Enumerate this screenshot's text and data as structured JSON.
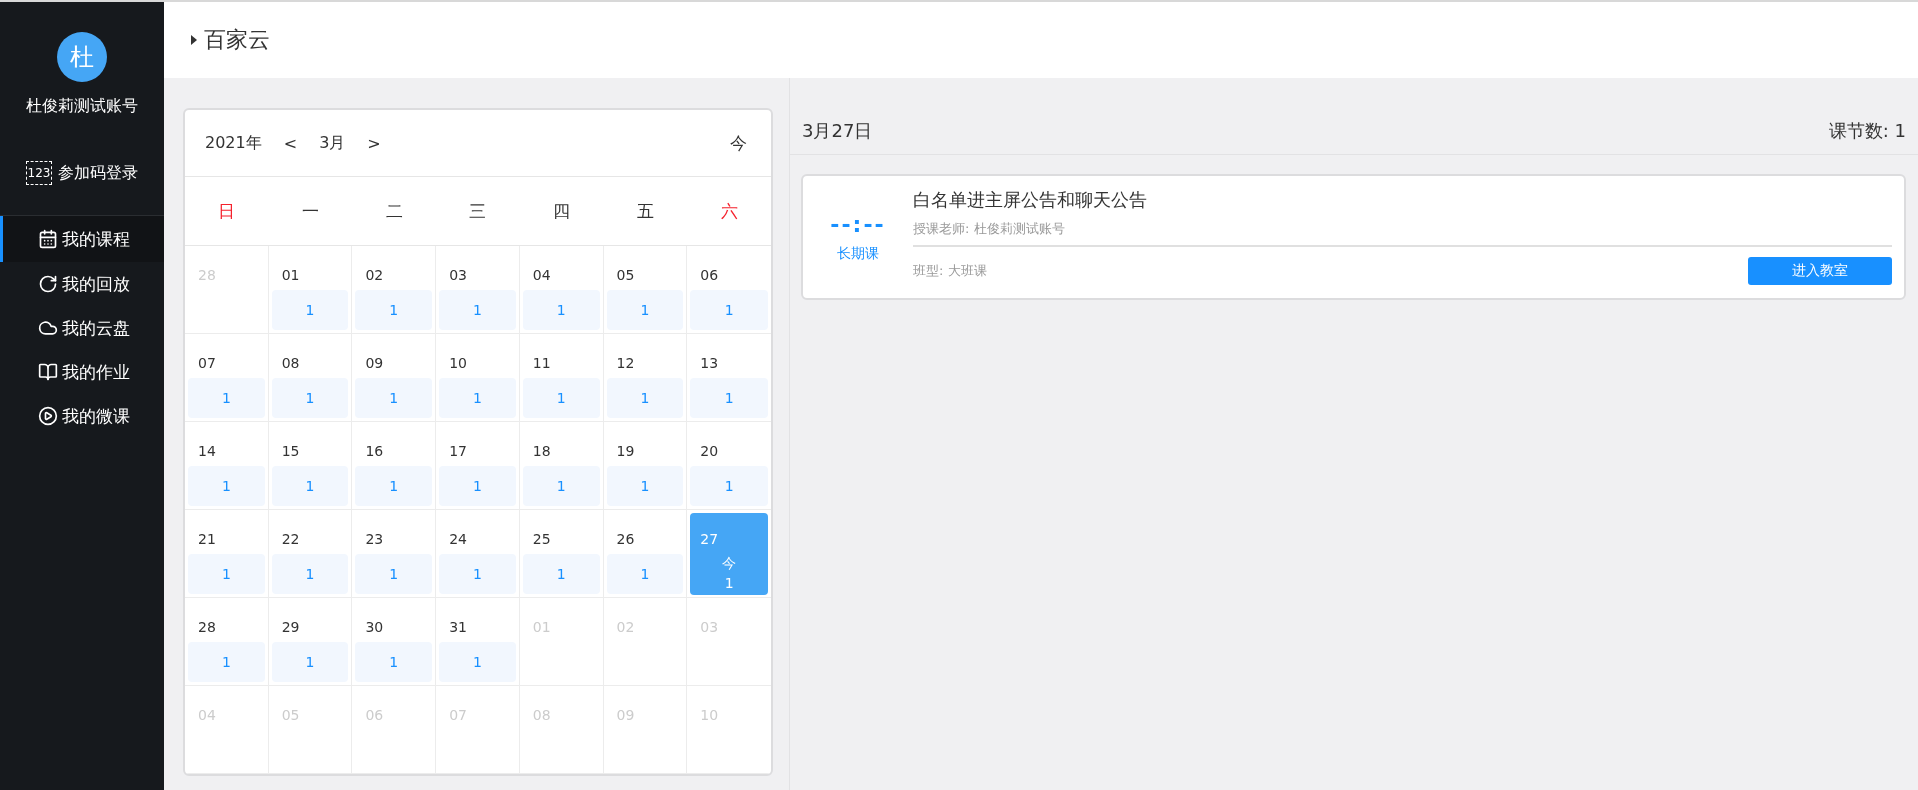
{
  "sidebar": {
    "avatar": "杜",
    "user_name": "杜俊莉测试账号",
    "join_code": {
      "icon_text": "123",
      "label": "参加码登录"
    },
    "items": [
      {
        "kind": "calendar",
        "label": "我的课程",
        "selected": true
      },
      {
        "kind": "replay",
        "label": "我的回放",
        "selected": false
      },
      {
        "kind": "cloud",
        "label": "我的云盘",
        "selected": false
      },
      {
        "kind": "homework",
        "label": "我的作业",
        "selected": false
      },
      {
        "kind": "play",
        "label": "我的微课",
        "selected": false
      }
    ]
  },
  "header": {
    "title": "百家云"
  },
  "calendar": {
    "year": "2021年",
    "prev": "<",
    "month": "3月",
    "next": ">",
    "today_button": "今",
    "weekdays": [
      {
        "label": "日",
        "weekend": true
      },
      {
        "label": "一",
        "weekend": false
      },
      {
        "label": "二",
        "weekend": false
      },
      {
        "label": "三",
        "weekend": false
      },
      {
        "label": "四",
        "weekend": false
      },
      {
        "label": "五",
        "weekend": false
      },
      {
        "label": "六",
        "weekend": true
      }
    ],
    "weeks": [
      [
        {
          "day": "28",
          "in_month": false,
          "selected": false
        },
        {
          "day": "01",
          "in_month": true,
          "selected": false,
          "count": "1"
        },
        {
          "day": "02",
          "in_month": true,
          "selected": false,
          "count": "1"
        },
        {
          "day": "03",
          "in_month": true,
          "selected": false,
          "count": "1"
        },
        {
          "day": "04",
          "in_month": true,
          "selected": false,
          "count": "1"
        },
        {
          "day": "05",
          "in_month": true,
          "selected": false,
          "count": "1"
        },
        {
          "day": "06",
          "in_month": true,
          "selected": false,
          "count": "1"
        }
      ],
      [
        {
          "day": "07",
          "in_month": true,
          "selected": false,
          "count": "1"
        },
        {
          "day": "08",
          "in_month": true,
          "selected": false,
          "count": "1"
        },
        {
          "day": "09",
          "in_month": true,
          "selected": false,
          "count": "1"
        },
        {
          "day": "10",
          "in_month": true,
          "selected": false,
          "count": "1"
        },
        {
          "day": "11",
          "in_month": true,
          "selected": false,
          "count": "1"
        },
        {
          "day": "12",
          "in_month": true,
          "selected": false,
          "count": "1"
        },
        {
          "day": "13",
          "in_month": true,
          "selected": false,
          "count": "1"
        }
      ],
      [
        {
          "day": "14",
          "in_month": true,
          "selected": false,
          "count": "1"
        },
        {
          "day": "15",
          "in_month": true,
          "selected": false,
          "count": "1"
        },
        {
          "day": "16",
          "in_month": true,
          "selected": false,
          "count": "1"
        },
        {
          "day": "17",
          "in_month": true,
          "selected": false,
          "count": "1"
        },
        {
          "day": "18",
          "in_month": true,
          "selected": false,
          "count": "1"
        },
        {
          "day": "19",
          "in_month": true,
          "selected": false,
          "count": "1"
        },
        {
          "day": "20",
          "in_month": true,
          "selected": false,
          "count": "1"
        }
      ],
      [
        {
          "day": "21",
          "in_month": true,
          "selected": false,
          "count": "1"
        },
        {
          "day": "22",
          "in_month": true,
          "selected": false,
          "count": "1"
        },
        {
          "day": "23",
          "in_month": true,
          "selected": false,
          "count": "1"
        },
        {
          "day": "24",
          "in_month": true,
          "selected": false,
          "count": "1"
        },
        {
          "day": "25",
          "in_month": true,
          "selected": false,
          "count": "1"
        },
        {
          "day": "26",
          "in_month": true,
          "selected": false,
          "count": "1"
        },
        {
          "day": "27",
          "in_month": true,
          "selected": true,
          "today_mark": "今",
          "count": "1"
        }
      ],
      [
        {
          "day": "28",
          "in_month": true,
          "selected": false,
          "count": "1"
        },
        {
          "day": "29",
          "in_month": true,
          "selected": false,
          "count": "1"
        },
        {
          "day": "30",
          "in_month": true,
          "selected": false,
          "count": "1"
        },
        {
          "day": "31",
          "in_month": true,
          "selected": false,
          "count": "1"
        },
        {
          "day": "01",
          "in_month": false,
          "selected": false
        },
        {
          "day": "02",
          "in_month": false,
          "selected": false
        },
        {
          "day": "03",
          "in_month": false,
          "selected": false
        }
      ],
      [
        {
          "day": "04",
          "in_month": false,
          "selected": false
        },
        {
          "day": "05",
          "in_month": false,
          "selected": false
        },
        {
          "day": "06",
          "in_month": false,
          "selected": false
        },
        {
          "day": "07",
          "in_month": false,
          "selected": false
        },
        {
          "day": "08",
          "in_month": false,
          "selected": false
        },
        {
          "day": "09",
          "in_month": false,
          "selected": false
        },
        {
          "day": "10",
          "in_month": false,
          "selected": false
        }
      ]
    ]
  },
  "day_panel": {
    "date": "3月27日",
    "lesson_count": "课节数: 1",
    "lessons": [
      {
        "time": "--:--",
        "type_tag": "长期课",
        "title": "白名单进主屏公告和聊天公告",
        "teacher": "授课老师: 杜俊莉测试账号",
        "class_type": "班型: 大班课",
        "button": "进入教室"
      }
    ]
  }
}
